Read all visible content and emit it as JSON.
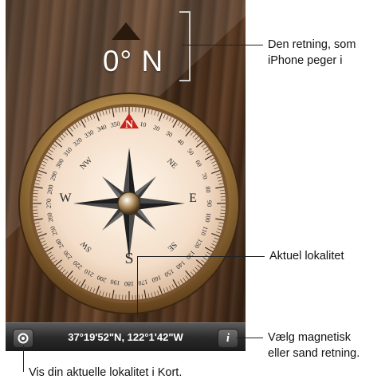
{
  "compass": {
    "heading": "0° N",
    "cardinals": [
      "N",
      "E",
      "S",
      "W"
    ],
    "intercardinals": [
      "NE",
      "SE",
      "SW",
      "NW"
    ],
    "degree_labels": [
      "0",
      "10",
      "20",
      "30",
      "40",
      "50",
      "60",
      "70",
      "80",
      "90",
      "100",
      "110",
      "120",
      "130",
      "140",
      "150",
      "160",
      "170",
      "180",
      "190",
      "200",
      "210",
      "220",
      "230",
      "240",
      "250",
      "260",
      "270",
      "280",
      "290",
      "300",
      "310",
      "320",
      "330",
      "340",
      "350"
    ],
    "colors": {
      "north_marker": "#c8241c",
      "dial_face": "#f3ddc8",
      "rim": "#8a6536"
    }
  },
  "toolbar": {
    "coordinates": "37°19'52\"N, 122°1'42\"W",
    "location_button_icon": "location-icon",
    "info_button_label": "i"
  },
  "annotations": {
    "direction": [
      "Den retning, som",
      "iPhone peger i"
    ],
    "location": "Aktuel lokalitet",
    "info": [
      "Vælg magnetisk",
      "eller sand retning."
    ],
    "map": "Vis din aktuelle lokalitet i Kort."
  }
}
